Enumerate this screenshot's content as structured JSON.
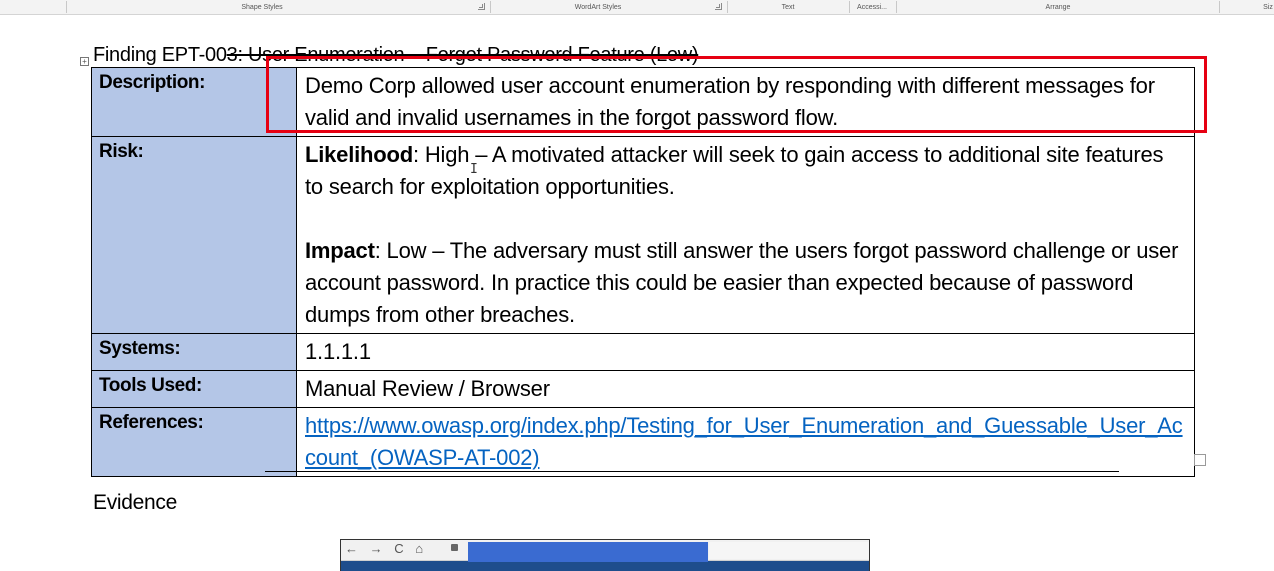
{
  "ribbon": {
    "groups": [
      "Shape Styles",
      "WordArt Styles",
      "Text",
      "Accessi...",
      "Arrange",
      "Siz"
    ]
  },
  "finding": {
    "title_prefix": "Finding EPT-00",
    "title_struck": "3: User Enumeration – Forgot Password Feature (Low)",
    "rows": {
      "description": {
        "label": "Description:",
        "text": "Demo Corp allowed user account enumeration by responding with different messages for valid and invalid usernames in the forgot password flow."
      },
      "risk": {
        "label": "Risk:",
        "likelihood_label": "Likelihood",
        "likelihood_text": ": High – A motivated attacker will seek to gain access to additional site features to search for exploitation opportunities.",
        "impact_label": "Impact",
        "impact_text": ": Low – The adversary must still answer the users forgot password challenge or user account password.  In practice this could be easier than expected because of password dumps from other breaches."
      },
      "systems": {
        "label": "Systems:",
        "text": "1.1.1.1"
      },
      "tools": {
        "label": "Tools Used:",
        "text": "Manual Review / Browser"
      },
      "references": {
        "label": "References:",
        "link": "https://www.owasp.org/index.php/Testing_for_User_Enumeration_and_Guessable_User_Account_(OWASP-AT-002)"
      }
    }
  },
  "evidence": {
    "heading": "Evidence"
  },
  "browser_preview": {
    "nav_glyphs": "← → C ⌂"
  },
  "colors": {
    "label_cell_bg": "#b4c6e7",
    "highlight_border": "#e60012",
    "link": "#0563c1"
  }
}
